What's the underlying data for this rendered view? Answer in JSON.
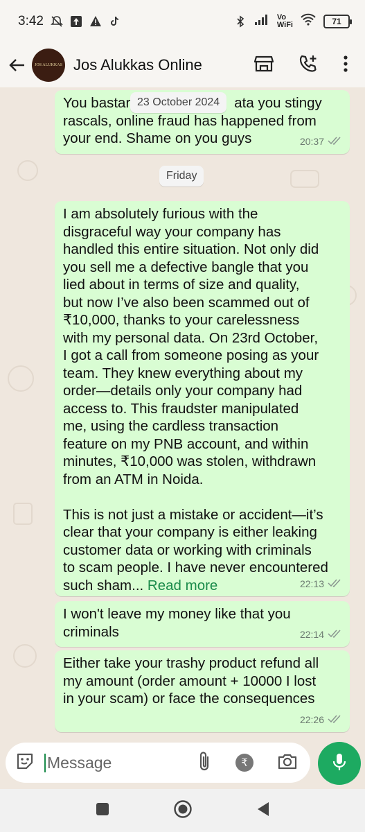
{
  "status_bar": {
    "time": "3:42",
    "vowifi_top": "Vo",
    "vowifi_bottom": "WiFi",
    "battery": "71"
  },
  "header": {
    "contact_name": "Jos Alukkas Online",
    "avatar_text": "JOS ALUKKAS"
  },
  "chat": {
    "date_pills": [
      "23 October 2024",
      "Friday"
    ],
    "messages": [
      {
        "text_a": "You bastar",
        "text_b": "ata you stingy",
        "text_rest": "rascals, online fraud has happened from\nyour end. Shame on you guys",
        "time": "20:37"
      },
      {
        "text": "I am absolutely furious with the\ndisgraceful way your company has\nhandled this entire situation. Not only did\nyou sell me a defective bangle that you\nlied about in terms of size and quality,\nbut now I’ve also been scammed out of\n₹10,000, thanks to your carelessness\nwith my personal data. On 23rd October,\nI got a call from someone posing as your\nteam. They knew everything about my\norder—details only your company had\naccess to. This fraudster manipulated\nme, using the cardless transaction\nfeature on my PNB account, and within\nminutes, ₹10,000 was stolen, withdrawn\nfrom an ATM in Noida.\n\nThis is not just a mistake or accident—it’s\nclear that your company is either leaking\ncustomer data or working with criminals\nto scam people. I have never encountered\nsuch sham... ",
        "read_more": "Read more",
        "time": "22:13"
      },
      {
        "text": "I won't leave my money like that you\ncriminals",
        "time": "22:14"
      },
      {
        "text": "Either take your trashy product refund all\nmy amount (order amount + 10000 I lost\nin your scam) or face the consequences",
        "time": "22:26"
      }
    ]
  },
  "composer": {
    "placeholder": "Message",
    "rupee_symbol": "₹"
  },
  "colors": {
    "bubble_out": "#d9fdd3",
    "accent": "#1daa61",
    "chat_bg": "#efe7de"
  }
}
